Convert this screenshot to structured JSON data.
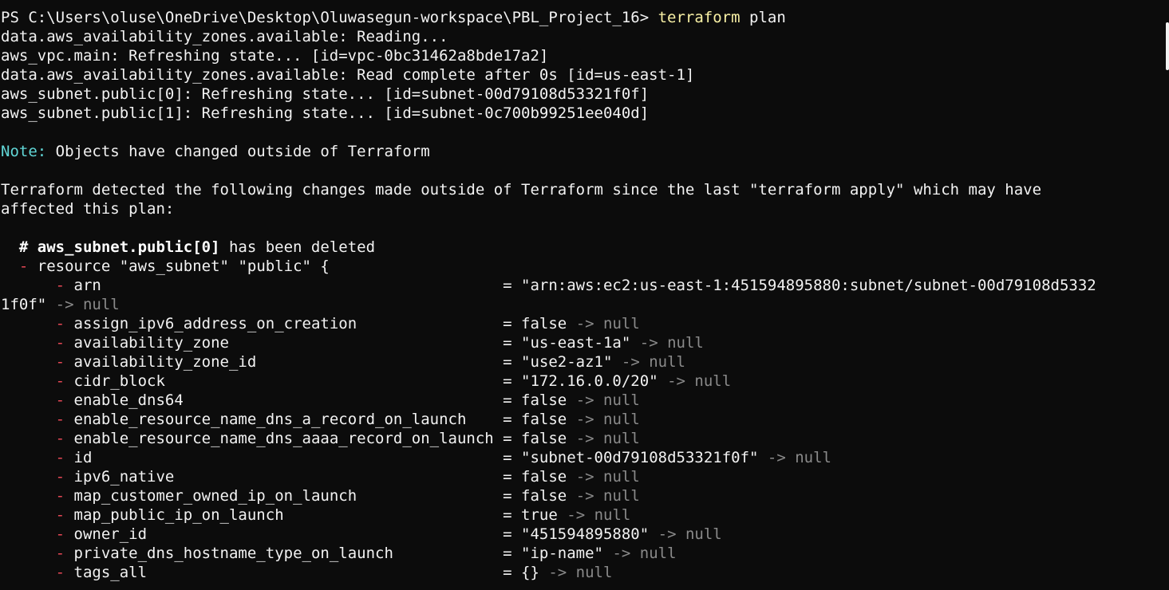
{
  "terminal": {
    "lines": [
      [
        {
          "t": "PS C:\\Users\\oluse\\OneDrive\\Desktop\\Oluwasegun-workspace\\PBL_Project_16> ",
          "c": "default"
        },
        {
          "t": "terraform",
          "c": "yellow"
        },
        {
          "t": " plan",
          "c": "default"
        }
      ],
      [
        {
          "t": "data.aws_availability_zones.available: Reading...",
          "c": "default"
        }
      ],
      [
        {
          "t": "aws_vpc.main: Refreshing state... [id=vpc-0bc31462a8bde17a2]",
          "c": "default"
        }
      ],
      [
        {
          "t": "data.aws_availability_zones.available: Read complete after 0s [id=us-east-1]",
          "c": "default"
        }
      ],
      [
        {
          "t": "aws_subnet.public[0]: Refreshing state... [id=subnet-00d79108d53321f0f]",
          "c": "default"
        }
      ],
      [
        {
          "t": "aws_subnet.public[1]: Refreshing state... [id=subnet-0c700b99251ee040d]",
          "c": "default"
        }
      ],
      [],
      [
        {
          "t": "Note:",
          "c": "cyan"
        },
        {
          "t": " Objects have changed outside of Terraform",
          "c": "default"
        }
      ],
      [],
      [
        {
          "t": "Terraform detected the following changes made outside of Terraform since the last \"terraform apply\" which may have",
          "c": "default"
        }
      ],
      [
        {
          "t": "affected this plan:",
          "c": "default"
        }
      ],
      [],
      [
        {
          "t": "  # aws_subnet.public[0]",
          "c": "bold"
        },
        {
          "t": " has been deleted",
          "c": "default"
        }
      ],
      [
        {
          "t": "  ",
          "c": "default"
        },
        {
          "t": "-",
          "c": "red"
        },
        {
          "t": " resource \"aws_subnet\" \"public\" {",
          "c": "default"
        }
      ],
      [
        {
          "t": "      ",
          "c": "default"
        },
        {
          "t": "-",
          "c": "red"
        },
        {
          "t": " arn                                            = \"arn:aws:ec2:us-east-1:451594895880:subnet/subnet-00d79108d5332",
          "c": "default"
        }
      ],
      [
        {
          "t": "1f0f\"",
          "c": "default"
        },
        {
          "t": " -> null",
          "c": "dim"
        }
      ],
      [
        {
          "t": "      ",
          "c": "default"
        },
        {
          "t": "-",
          "c": "red"
        },
        {
          "t": " assign_ipv6_address_on_creation                = false",
          "c": "default"
        },
        {
          "t": " -> null",
          "c": "dim"
        }
      ],
      [
        {
          "t": "      ",
          "c": "default"
        },
        {
          "t": "-",
          "c": "red"
        },
        {
          "t": " availability_zone                              = \"us-east-1a\"",
          "c": "default"
        },
        {
          "t": " -> null",
          "c": "dim"
        }
      ],
      [
        {
          "t": "      ",
          "c": "default"
        },
        {
          "t": "-",
          "c": "red"
        },
        {
          "t": " availability_zone_id                           = \"use2-az1\"",
          "c": "default"
        },
        {
          "t": " -> null",
          "c": "dim"
        }
      ],
      [
        {
          "t": "      ",
          "c": "default"
        },
        {
          "t": "-",
          "c": "red"
        },
        {
          "t": " cidr_block                                     = \"172.16.0.0/20\"",
          "c": "default"
        },
        {
          "t": " -> null",
          "c": "dim"
        }
      ],
      [
        {
          "t": "      ",
          "c": "default"
        },
        {
          "t": "-",
          "c": "red"
        },
        {
          "t": " enable_dns64                                   = false",
          "c": "default"
        },
        {
          "t": " -> null",
          "c": "dim"
        }
      ],
      [
        {
          "t": "      ",
          "c": "default"
        },
        {
          "t": "-",
          "c": "red"
        },
        {
          "t": " enable_resource_name_dns_a_record_on_launch    = false",
          "c": "default"
        },
        {
          "t": " -> null",
          "c": "dim"
        }
      ],
      [
        {
          "t": "      ",
          "c": "default"
        },
        {
          "t": "-",
          "c": "red"
        },
        {
          "t": " enable_resource_name_dns_aaaa_record_on_launch = false",
          "c": "default"
        },
        {
          "t": " -> null",
          "c": "dim"
        }
      ],
      [
        {
          "t": "      ",
          "c": "default"
        },
        {
          "t": "-",
          "c": "red"
        },
        {
          "t": " id                                             = \"subnet-00d79108d53321f0f\"",
          "c": "default"
        },
        {
          "t": " -> null",
          "c": "dim"
        }
      ],
      [
        {
          "t": "      ",
          "c": "default"
        },
        {
          "t": "-",
          "c": "red"
        },
        {
          "t": " ipv6_native                                    = false",
          "c": "default"
        },
        {
          "t": " -> null",
          "c": "dim"
        }
      ],
      [
        {
          "t": "      ",
          "c": "default"
        },
        {
          "t": "-",
          "c": "red"
        },
        {
          "t": " map_customer_owned_ip_on_launch                = false",
          "c": "default"
        },
        {
          "t": " -> null",
          "c": "dim"
        }
      ],
      [
        {
          "t": "      ",
          "c": "default"
        },
        {
          "t": "-",
          "c": "red"
        },
        {
          "t": " map_public_ip_on_launch                        = true",
          "c": "default"
        },
        {
          "t": " -> null",
          "c": "dim"
        }
      ],
      [
        {
          "t": "      ",
          "c": "default"
        },
        {
          "t": "-",
          "c": "red"
        },
        {
          "t": " owner_id                                       = \"451594895880\"",
          "c": "default"
        },
        {
          "t": " -> null",
          "c": "dim"
        }
      ],
      [
        {
          "t": "      ",
          "c": "default"
        },
        {
          "t": "-",
          "c": "red"
        },
        {
          "t": " private_dns_hostname_type_on_launch            = \"ip-name\"",
          "c": "default"
        },
        {
          "t": " -> null",
          "c": "dim"
        }
      ],
      [
        {
          "t": "      ",
          "c": "default"
        },
        {
          "t": "-",
          "c": "red"
        },
        {
          "t": " tags_all                                       = {}",
          "c": "default"
        },
        {
          "t": " -> null",
          "c": "dim"
        }
      ]
    ]
  },
  "colors": {
    "background": "#0c0c0c",
    "default": "#f2f2f2",
    "yellow": "#f9f1a5",
    "cyan": "#61d6d6",
    "red": "#e74856",
    "dim": "#8a8a8a"
  }
}
